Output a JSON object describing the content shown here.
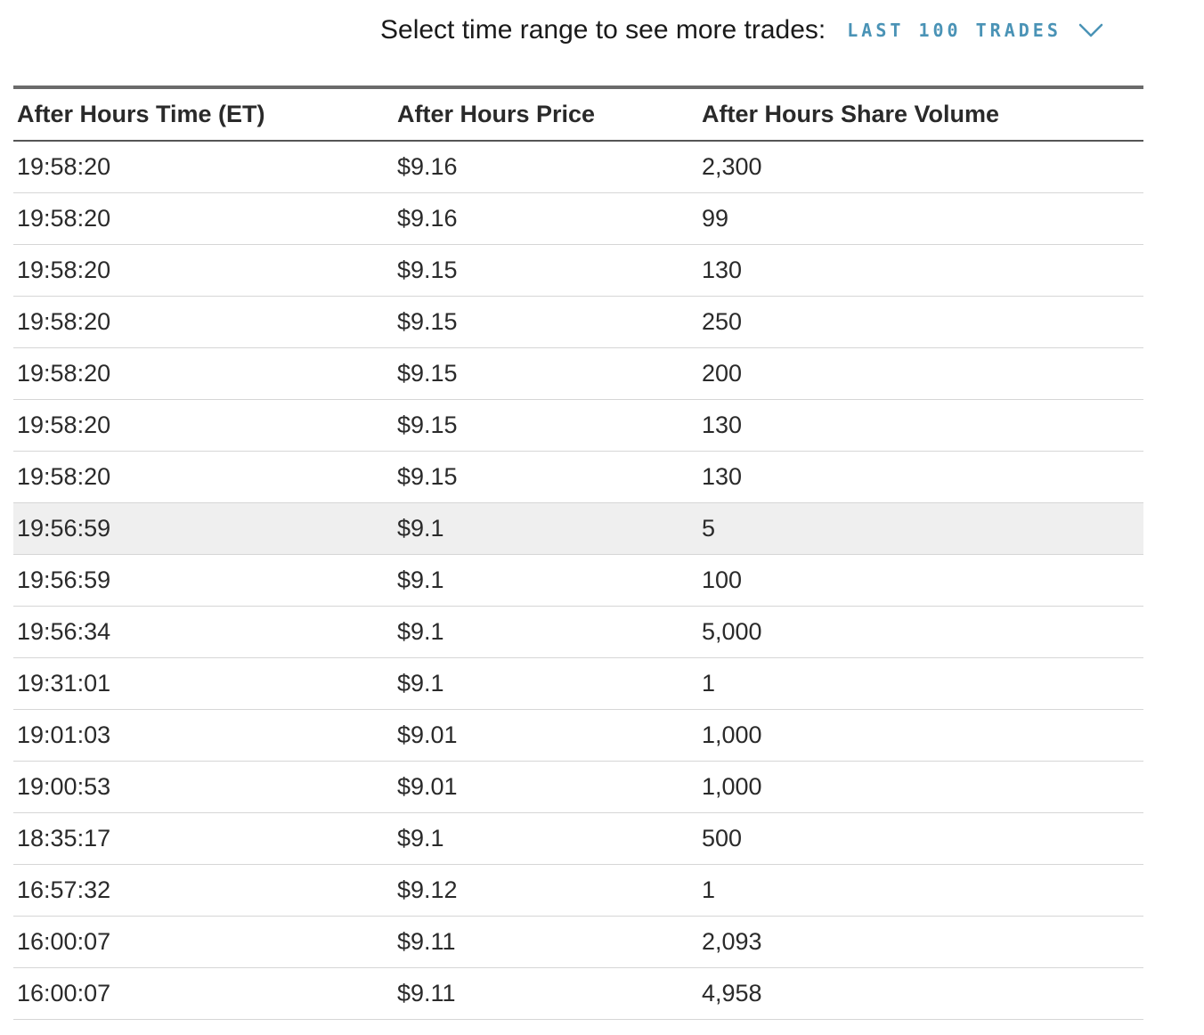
{
  "range_selector": {
    "label": "Select time range to see more trades:",
    "selected": "LAST 100 TRADES",
    "icon": "chevron-down-icon",
    "accent_color": "#4a93b6"
  },
  "table": {
    "columns": [
      "After Hours Time (ET)",
      "After Hours Price",
      "After Hours Share Volume"
    ],
    "rows": [
      {
        "time": "19:58:20",
        "price": "$9.16",
        "volume": "2,300"
      },
      {
        "time": "19:58:20",
        "price": "$9.16",
        "volume": "99"
      },
      {
        "time": "19:58:20",
        "price": "$9.15",
        "volume": "130"
      },
      {
        "time": "19:58:20",
        "price": "$9.15",
        "volume": "250"
      },
      {
        "time": "19:58:20",
        "price": "$9.15",
        "volume": "200"
      },
      {
        "time": "19:58:20",
        "price": "$9.15",
        "volume": "130"
      },
      {
        "time": "19:58:20",
        "price": "$9.15",
        "volume": "130"
      },
      {
        "time": "19:56:59",
        "price": "$9.1",
        "volume": "5",
        "highlighted": true
      },
      {
        "time": "19:56:59",
        "price": "$9.1",
        "volume": "100"
      },
      {
        "time": "19:56:34",
        "price": "$9.1",
        "volume": "5,000"
      },
      {
        "time": "19:31:01",
        "price": "$9.1",
        "volume": "1"
      },
      {
        "time": "19:01:03",
        "price": "$9.01",
        "volume": "1,000"
      },
      {
        "time": "19:00:53",
        "price": "$9.01",
        "volume": "1,000"
      },
      {
        "time": "18:35:17",
        "price": "$9.1",
        "volume": "500"
      },
      {
        "time": "16:57:32",
        "price": "$9.12",
        "volume": "1"
      },
      {
        "time": "16:00:07",
        "price": "$9.11",
        "volume": "2,093"
      },
      {
        "time": "16:00:07",
        "price": "$9.11",
        "volume": "4,958"
      }
    ]
  }
}
